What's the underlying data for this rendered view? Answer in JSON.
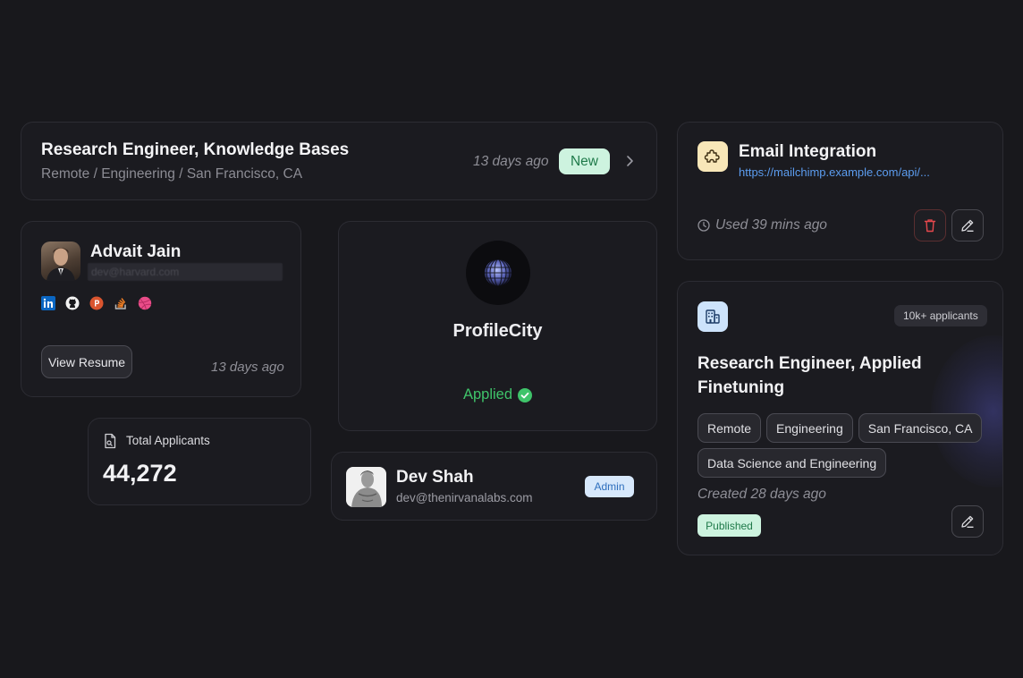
{
  "job_row": {
    "title": "Research Engineer, Knowledge Bases",
    "subtitle": "Remote / Engineering / San Francisco, CA",
    "posted": "13 days ago",
    "badge": "New"
  },
  "candidate": {
    "name": "Advait Jain",
    "email": "dev@harvard.com",
    "socials": [
      "linkedin-icon",
      "github-icon",
      "producthunt-icon",
      "stackoverflow-icon",
      "dribbble-icon"
    ],
    "resume_label": "View Resume",
    "posted": "13 days ago"
  },
  "total": {
    "label": "Total Applicants",
    "value": "44,272"
  },
  "profilecity": {
    "name": "ProfileCity",
    "status": "Applied",
    "status_color": "#3fc46a"
  },
  "dev": {
    "name": "Dev Shah",
    "email": "dev@thenirvanalabs.com",
    "role": "Admin"
  },
  "integration": {
    "title": "Email Integration",
    "url": "https://mailchimp.example.com/api/...",
    "used": "Used 39 mins ago"
  },
  "job2": {
    "applicants": "10k+ applicants",
    "title": "Research Engineer, Applied Finetuning",
    "tags": [
      "Remote",
      "Engineering",
      "San Francisco, CA",
      "Data Science and Engineering"
    ],
    "created": "Created 28 days ago",
    "status": "Published"
  },
  "colors": {
    "background": "#18181c",
    "card": "#1b1b20",
    "success_badge": "#cdf3df",
    "admin_badge": "#d7e8fb",
    "link": "#5c9df0",
    "danger": "#e5484d"
  }
}
